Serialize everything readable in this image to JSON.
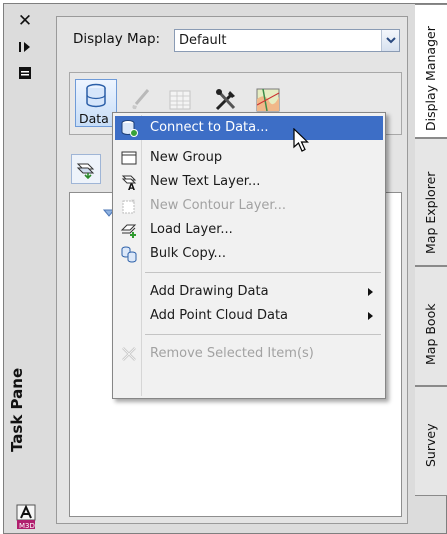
{
  "left_strip": {
    "close_glyph": "✕",
    "title": "Task Pane"
  },
  "display_map": {
    "label": "Display Map:",
    "value": "Default"
  },
  "toolbar": {
    "data_label": "Data"
  },
  "menu": {
    "items": [
      {
        "label": "Connect to Data...",
        "icon": "connect-data-icon",
        "state": "highlighted"
      },
      {
        "label": "New Group",
        "icon": "new-group-icon",
        "state": "enabled"
      },
      {
        "label": "New Text Layer...",
        "icon": "text-layer-icon",
        "state": "enabled"
      },
      {
        "label": "New Contour Layer...",
        "icon": "contour-layer-icon",
        "state": "disabled"
      },
      {
        "label": "Load Layer...",
        "icon": "load-layer-icon",
        "state": "enabled"
      },
      {
        "label": "Bulk Copy...",
        "icon": "bulk-copy-icon",
        "state": "enabled"
      },
      {
        "label": "Add Drawing Data",
        "icon": "",
        "state": "enabled",
        "submenu": true
      },
      {
        "label": "Add Point Cloud Data",
        "icon": "",
        "state": "enabled",
        "submenu": true
      },
      {
        "label": "Remove Selected Item(s)",
        "icon": "remove-icon",
        "state": "disabled"
      }
    ]
  },
  "right_tabs": [
    {
      "label": "Display Manager",
      "active": true
    },
    {
      "label": "Map Explorer",
      "active": false
    },
    {
      "label": "Map Book",
      "active": false
    },
    {
      "label": "Survey",
      "active": false
    }
  ],
  "colors": {
    "highlight": "#3d6ec6",
    "panel": "#e4e4e4",
    "disabled_text": "#a2a2a2"
  }
}
